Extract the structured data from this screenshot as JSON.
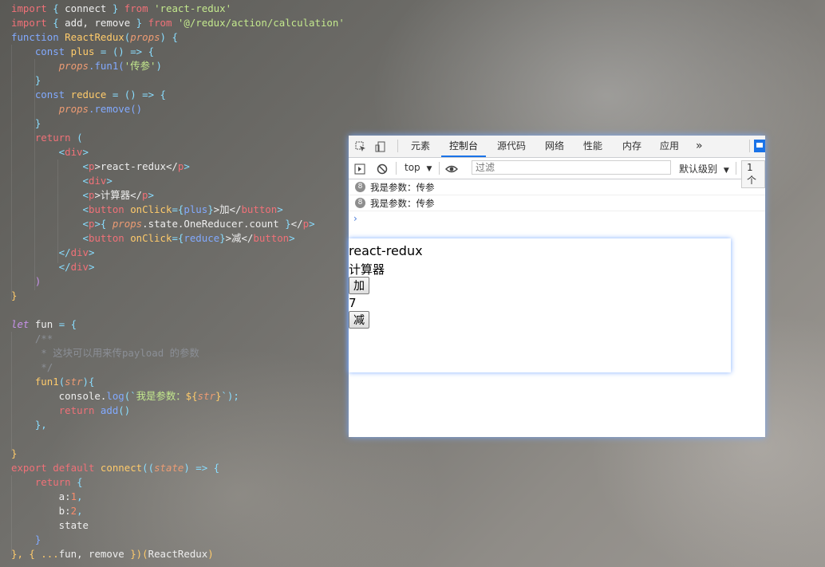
{
  "editor": {
    "lines": [
      [
        [
          "import",
          "kw"
        ],
        [
          " { ",
          "pun"
        ],
        [
          "connect",
          "plain"
        ],
        [
          " } ",
          "pun"
        ],
        [
          "from",
          "kw"
        ],
        [
          " ",
          "plain"
        ],
        [
          "'react-redux'",
          "str"
        ]
      ],
      [
        [
          "import",
          "kw"
        ],
        [
          " { ",
          "pun"
        ],
        [
          "add, remove",
          "plain"
        ],
        [
          " } ",
          "pun"
        ],
        [
          "from",
          "kw"
        ],
        [
          " ",
          "plain"
        ],
        [
          "'@/redux/action/calculation'",
          "str"
        ]
      ],
      [
        [
          "function",
          "prop"
        ],
        [
          " ",
          "plain"
        ],
        [
          "ReactRedux",
          "fn"
        ],
        [
          "(",
          "pun"
        ],
        [
          "props",
          "var"
        ],
        [
          ") {",
          "pun"
        ]
      ],
      [
        [
          "    ",
          "plain"
        ],
        [
          "const",
          "prop"
        ],
        [
          " plus ",
          "fn"
        ],
        [
          "= () => {",
          "pun"
        ]
      ],
      [
        [
          "        ",
          "plain"
        ],
        [
          "props",
          "var"
        ],
        [
          ".fun1(",
          "prop"
        ],
        [
          "'传参'",
          "str"
        ],
        [
          ")",
          "pun"
        ]
      ],
      [
        [
          "    }",
          "pun"
        ]
      ],
      [
        [
          "    ",
          "plain"
        ],
        [
          "const",
          "prop"
        ],
        [
          " reduce ",
          "fn"
        ],
        [
          "= () => {",
          "pun"
        ]
      ],
      [
        [
          "        ",
          "plain"
        ],
        [
          "props",
          "var"
        ],
        [
          ".remove()",
          "prop"
        ]
      ],
      [
        [
          "    }",
          "pun"
        ]
      ],
      [
        [
          "    ",
          "plain"
        ],
        [
          "return",
          "kw"
        ],
        [
          " (",
          "pun"
        ]
      ],
      [
        [
          "        <",
          "pun"
        ],
        [
          "div",
          "tag"
        ],
        [
          ">",
          "pun"
        ]
      ],
      [
        [
          "            <",
          "pun"
        ],
        [
          "p",
          "tag"
        ],
        [
          ">react-redux</",
          "plain"
        ],
        [
          "p",
          "tag"
        ],
        [
          ">",
          "pun"
        ]
      ],
      [
        [
          "            <",
          "pun"
        ],
        [
          "div",
          "tag"
        ],
        [
          ">",
          "pun"
        ]
      ],
      [
        [
          "            <",
          "pun"
        ],
        [
          "p",
          "tag"
        ],
        [
          ">计算器</",
          "plain"
        ],
        [
          "p",
          "tag"
        ],
        [
          ">",
          "pun"
        ]
      ],
      [
        [
          "            <",
          "pun"
        ],
        [
          "button",
          "tag"
        ],
        [
          " onClick",
          "fn"
        ],
        [
          "={",
          "pun"
        ],
        [
          "plus",
          "prop"
        ],
        [
          "}",
          "pun"
        ],
        [
          ">加</",
          "plain"
        ],
        [
          "button",
          "tag"
        ],
        [
          ">",
          "pun"
        ]
      ],
      [
        [
          "            <",
          "pun"
        ],
        [
          "p",
          "tag"
        ],
        [
          ">",
          "pun"
        ],
        [
          "{ ",
          "pun"
        ],
        [
          "props",
          "var"
        ],
        [
          ".state.OneReducer.count ",
          "plain"
        ],
        [
          "}",
          "pun"
        ],
        [
          "</",
          "plain"
        ],
        [
          "p",
          "tag"
        ],
        [
          ">",
          "pun"
        ]
      ],
      [
        [
          "            <",
          "pun"
        ],
        [
          "button",
          "tag"
        ],
        [
          " onClick",
          "fn"
        ],
        [
          "={",
          "pun"
        ],
        [
          "reduce",
          "prop"
        ],
        [
          "}",
          "pun"
        ],
        [
          ">减</",
          "plain"
        ],
        [
          "button",
          "tag"
        ],
        [
          ">",
          "pun"
        ]
      ],
      [
        [
          "        </",
          "pun"
        ],
        [
          "div",
          "tag"
        ],
        [
          ">",
          "pun"
        ]
      ],
      [
        [
          "        </",
          "pun"
        ],
        [
          "div",
          "tag"
        ],
        [
          ">",
          "pun"
        ]
      ],
      [
        [
          "    )",
          "attr"
        ]
      ],
      [
        [
          "}",
          "fn"
        ]
      ],
      [
        [
          "",
          "plain"
        ]
      ],
      [
        [
          "let",
          "store"
        ],
        [
          " fun ",
          "plain"
        ],
        [
          "= {",
          "pun"
        ]
      ],
      [
        [
          "    /**",
          "cm"
        ]
      ],
      [
        [
          "     * 这块可以用来传payload 的参数",
          "cm"
        ]
      ],
      [
        [
          "     */",
          "cm"
        ]
      ],
      [
        [
          "    ",
          "plain"
        ],
        [
          "fun1",
          "fn"
        ],
        [
          "(",
          "pun"
        ],
        [
          "str",
          "var"
        ],
        [
          "){",
          "pun"
        ]
      ],
      [
        [
          "        console.",
          "plain"
        ],
        [
          "log",
          "prop"
        ],
        [
          "(`",
          "pun"
        ],
        [
          "我是参数：",
          "str"
        ],
        [
          "${",
          "fn"
        ],
        [
          "str",
          "var"
        ],
        [
          "}",
          "fn"
        ],
        [
          "`);",
          "pun"
        ]
      ],
      [
        [
          "        ",
          "plain"
        ],
        [
          "return",
          "kw"
        ],
        [
          " add",
          "prop"
        ],
        [
          "()",
          "pun"
        ]
      ],
      [
        [
          "    },",
          "pun"
        ]
      ],
      [
        [
          "",
          "plain"
        ]
      ],
      [
        [
          "}",
          "fn"
        ]
      ],
      [
        [
          "export",
          "kw"
        ],
        [
          " ",
          "plain"
        ],
        [
          "default",
          "kw"
        ],
        [
          " connect",
          "fn"
        ],
        [
          "((",
          "pun"
        ],
        [
          "state",
          "var"
        ],
        [
          ") => {",
          "pun"
        ]
      ],
      [
        [
          "    ",
          "plain"
        ],
        [
          "return",
          "kw"
        ],
        [
          " {",
          "pun"
        ]
      ],
      [
        [
          "        a:",
          "plain"
        ],
        [
          "1",
          "num"
        ],
        [
          ",",
          "pun"
        ]
      ],
      [
        [
          "        b:",
          "plain"
        ],
        [
          "2",
          "num"
        ],
        [
          ",",
          "pun"
        ]
      ],
      [
        [
          "        state",
          "plain"
        ]
      ],
      [
        [
          "    }",
          "prop"
        ]
      ],
      [
        [
          "}, { ...",
          "fn"
        ],
        [
          "fun, remove ",
          "plain"
        ],
        [
          "})(",
          "fn"
        ],
        [
          "ReactRedux",
          "plain"
        ],
        [
          ")",
          "fn"
        ]
      ]
    ]
  },
  "devtools": {
    "tabs": [
      "元素",
      "控制台",
      "源代码",
      "网络",
      "性能",
      "内存",
      "应用"
    ],
    "active_tab": "控制台",
    "more_label": "»",
    "context": "top",
    "filter_placeholder": "过滤",
    "level_label": "默认级别",
    "issues_label": "1 个",
    "log_badge": "8",
    "logs": [
      "我是参数：传参",
      "我是参数：传参"
    ],
    "prompt": "›"
  },
  "app": {
    "title": "react-redux",
    "subtitle": "计算器",
    "add_label": "加",
    "count": "7",
    "reduce_label": "减"
  },
  "colors": {
    "keyword": "#f07178",
    "string": "#c3e88d",
    "function": "#ffcb6b",
    "accent": "#1a73e8"
  }
}
